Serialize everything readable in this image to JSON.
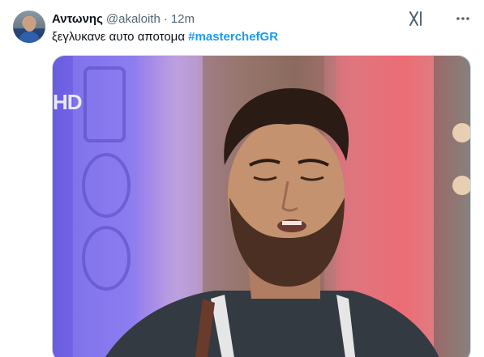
{
  "tweet": {
    "author": {
      "display_name": "Αντωνης",
      "handle": "@akaloith",
      "separator": "·",
      "time": "12m"
    },
    "text": "ξεγλυκανε αυτο αποτομα",
    "hashtag": "#masterchefGR",
    "media": {
      "watermark": "HD"
    },
    "icons": {
      "grok": "grok-icon",
      "more": "more-options-icon"
    }
  },
  "colors": {
    "text": "#0f1419",
    "secondary": "#536471",
    "link": "#1d9bf0"
  }
}
